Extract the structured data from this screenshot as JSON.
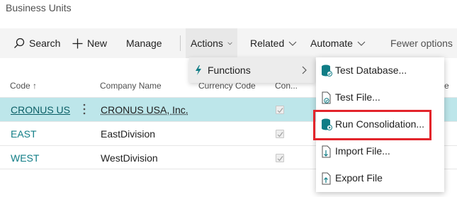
{
  "page": {
    "title": "Business Units"
  },
  "toolbar": {
    "search_label": "Search",
    "new_label": "New",
    "manage_label": "Manage",
    "actions_label": "Actions",
    "related_label": "Related",
    "automate_label": "Automate",
    "fewer_label": "Fewer options"
  },
  "columns": {
    "code": "Code",
    "company": "Company Name",
    "currency": "Currency Code",
    "consolidate": "Con...",
    "trailing": "e"
  },
  "rows": [
    {
      "code": "CRONUS US",
      "company": "CRONUS USA, Inc."
    },
    {
      "code": "EAST",
      "company": "EastDivision"
    },
    {
      "code": "WEST",
      "company": "WestDivision"
    }
  ],
  "menu_actions": {
    "functions_label": "Functions"
  },
  "menu_functions": {
    "items": [
      {
        "label": "Test Database...",
        "icon": "database-check-icon"
      },
      {
        "label": "Test File...",
        "icon": "file-check-icon"
      },
      {
        "label": "Run Consolidation...",
        "icon": "database-run-icon"
      },
      {
        "label": "Import File...",
        "icon": "file-import-icon"
      },
      {
        "label": "Export File",
        "icon": "file-export-icon"
      }
    ]
  },
  "colors": {
    "accent": "#107d86",
    "selected_row": "#bde6ea",
    "highlight": "#e3242b"
  }
}
